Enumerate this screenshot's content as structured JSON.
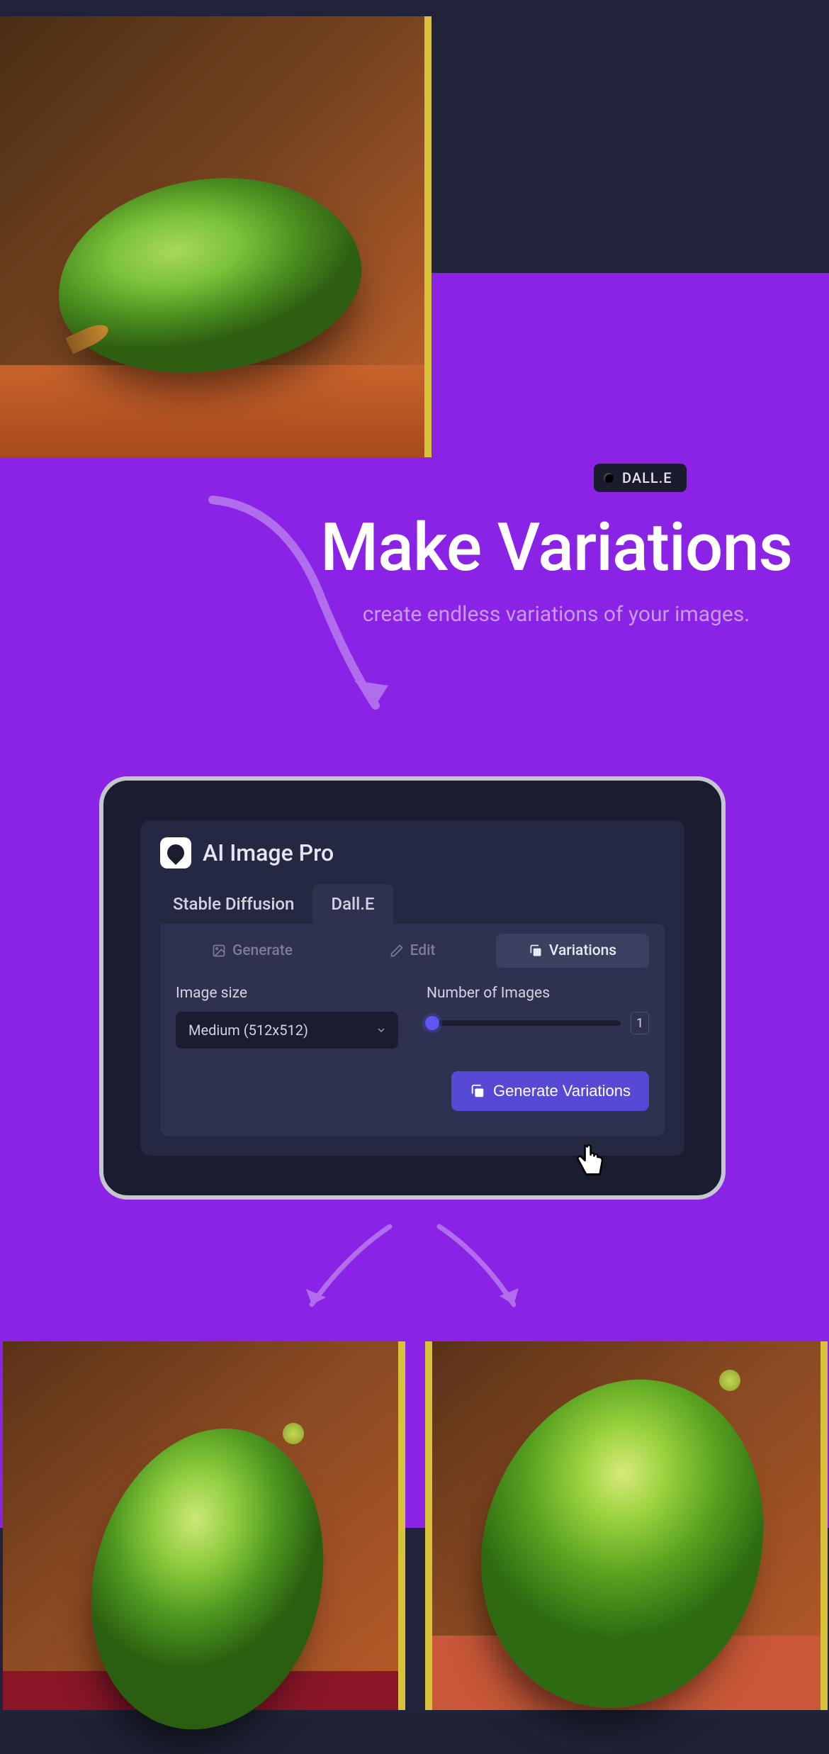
{
  "badge": {
    "label": "DALL.E"
  },
  "headline": {
    "title": "Make Variations",
    "subtitle": "create endless variations of your images."
  },
  "app": {
    "title": "AI Image Pro",
    "tabs": [
      {
        "label": "Stable Diffusion",
        "active": false
      },
      {
        "label": "Dall.E",
        "active": true
      }
    ],
    "subtabs": [
      {
        "label": "Generate",
        "icon": "image-icon",
        "active": false
      },
      {
        "label": "Edit",
        "icon": "pencil-icon",
        "active": false
      },
      {
        "label": "Variations",
        "icon": "copy-icon",
        "active": true
      }
    ],
    "image_size": {
      "label": "Image size",
      "value": "Medium (512x512)"
    },
    "num_images": {
      "label": "Number of Images",
      "value": "1"
    },
    "generate_button": "Generate Variations"
  }
}
